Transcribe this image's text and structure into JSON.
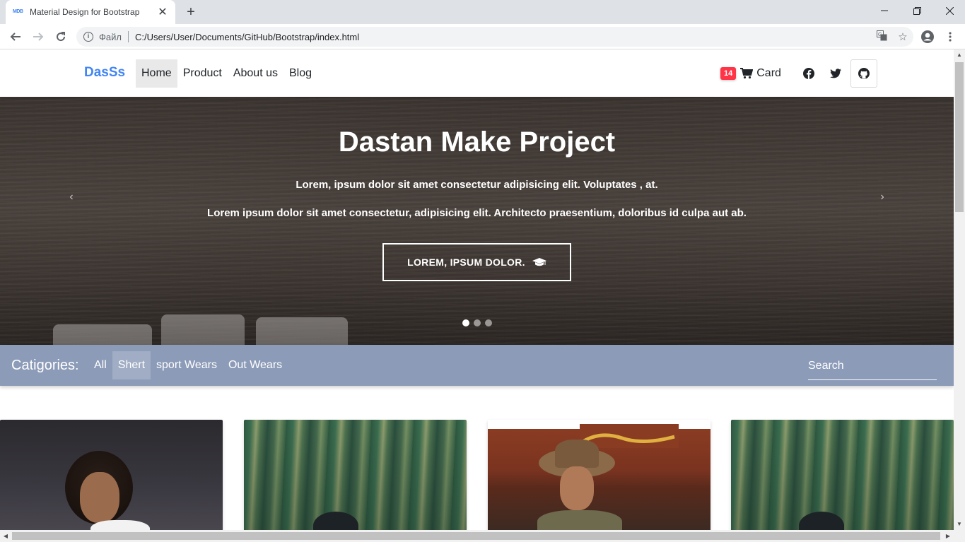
{
  "browser": {
    "tab_title": "Material Design for Bootstrap",
    "tab_favicon": "MDB",
    "new_tab_label": "+",
    "address_prefix": "Файл",
    "address_url": "C:/Users/User/Documents/GitHub/Bootstrap/index.html"
  },
  "navbar": {
    "brand": "DasSs",
    "links": [
      {
        "label": "Home",
        "active": true
      },
      {
        "label": "Product"
      },
      {
        "label": "About us"
      },
      {
        "label": "Blog"
      }
    ],
    "cart_count": "14",
    "cart_label": "Card"
  },
  "hero": {
    "title": "Dastan Make Project",
    "line1": "Lorem, ipsum dolor sit amet consectetur adipisicing elit. Voluptates , at.",
    "line2": "Lorem ipsum dolor sit amet consectetur, adipisicing elit. Architecto praesentium, doloribus id culpa aut ab.",
    "button_label": "LOREM, IPSUM DOLOR.",
    "slide_count": 3,
    "active_slide": 1
  },
  "categories": {
    "label": "Catigories:",
    "items": [
      {
        "label": "All"
      },
      {
        "label": "Shert",
        "active": true
      },
      {
        "label": "sport Wears"
      },
      {
        "label": "Out Wears"
      }
    ],
    "search_placeholder": "Search"
  },
  "colors": {
    "brand": "#4285f4",
    "badge": "#ff3547",
    "category_bar": "#8c9bb8"
  },
  "icons": {
    "cart": "shopping-cart-icon",
    "facebook": "facebook-icon",
    "twitter": "twitter-icon",
    "github": "github-icon",
    "hero_button": "graduation-cap-icon"
  }
}
